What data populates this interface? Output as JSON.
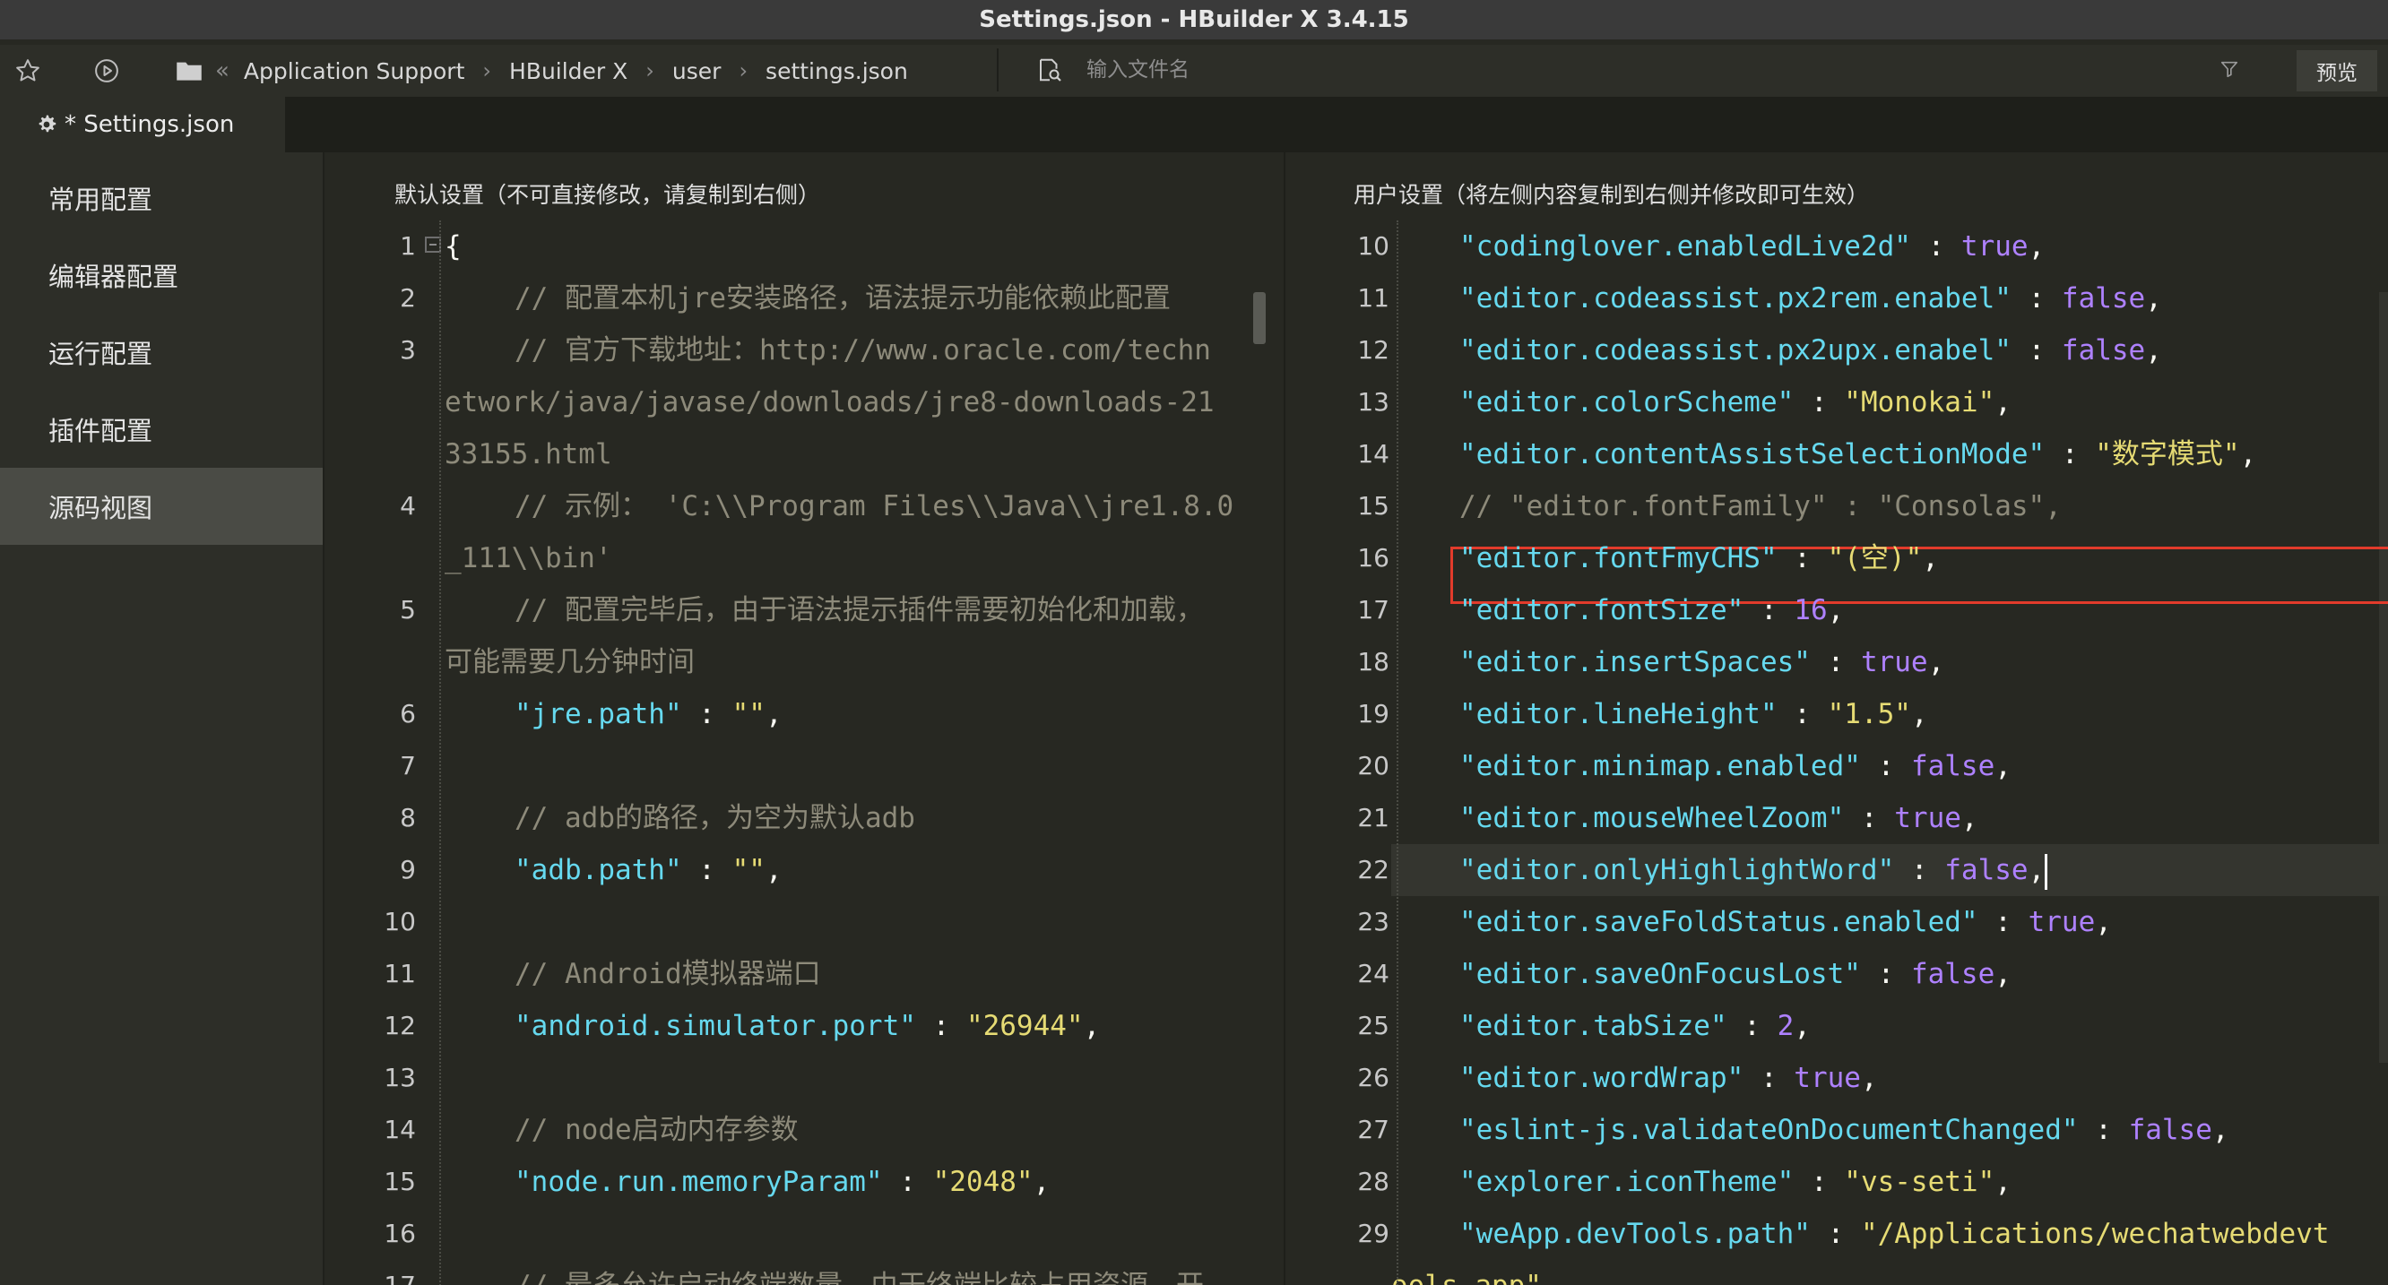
{
  "window": {
    "title": "Settings.json - HBuilder X 3.4.15"
  },
  "toolbar": {
    "breadcrumb": [
      "Application Support",
      "HBuilder X",
      "user",
      "settings.json"
    ],
    "search_placeholder": "输入文件名",
    "preview_label": "预览"
  },
  "tab": {
    "label": "* Settings.json"
  },
  "sidebar": {
    "items": [
      {
        "label": "常用配置",
        "active": false
      },
      {
        "label": "编辑器配置",
        "active": false
      },
      {
        "label": "运行配置",
        "active": false
      },
      {
        "label": "插件配置",
        "active": false
      },
      {
        "label": "源码视图",
        "active": true
      }
    ]
  },
  "left_pane": {
    "header": "默认设置（不可直接修改，请复制到右侧）",
    "lines": [
      {
        "n": "1",
        "t": [
          [
            "p",
            "{"
          ]
        ]
      },
      {
        "n": "2",
        "t": [
          [
            "c",
            "// "
          ],
          [
            "cz",
            "配置本机"
          ],
          [
            "c",
            "jre"
          ],
          [
            "cz",
            "安装路径，语法提示功能依赖此配置"
          ]
        ]
      },
      {
        "n": "3",
        "t": [
          [
            "c",
            "// "
          ],
          [
            "cz",
            "官方下载地址："
          ],
          [
            "c",
            "http://www.oracle.com/techn"
          ]
        ]
      },
      {
        "n": "",
        "t": [
          [
            "c",
            "etwork/java/javase/downloads/jre8-downloads-21"
          ]
        ]
      },
      {
        "n": "",
        "t": [
          [
            "c",
            "33155.html"
          ]
        ]
      },
      {
        "n": "4",
        "t": [
          [
            "c",
            "// "
          ],
          [
            "cz",
            "示例："
          ],
          [
            "c",
            " 'C:\\\\Program Files\\\\Java\\\\jre1.8.0"
          ]
        ]
      },
      {
        "n": "",
        "t": [
          [
            "c",
            "_111\\\\bin'"
          ]
        ]
      },
      {
        "n": "5",
        "t": [
          [
            "c",
            "// "
          ],
          [
            "cz",
            "配置完毕后，由于语法提示插件需要初始化和加载，"
          ]
        ]
      },
      {
        "n": "",
        "t": [
          [
            "cz",
            "可能需要几分钟时间"
          ]
        ]
      },
      {
        "n": "6",
        "t": [
          [
            "k",
            "\"jre.path\""
          ],
          [
            "p",
            " : "
          ],
          [
            "s",
            "\"\""
          ],
          [
            "p",
            ","
          ]
        ]
      },
      {
        "n": "7",
        "t": []
      },
      {
        "n": "8",
        "t": [
          [
            "c",
            "// adb"
          ],
          [
            "cz",
            "的路径，为空为默认"
          ],
          [
            "c",
            "adb"
          ]
        ]
      },
      {
        "n": "9",
        "t": [
          [
            "k",
            "\"adb.path\""
          ],
          [
            "p",
            " : "
          ],
          [
            "s",
            "\"\""
          ],
          [
            "p",
            ","
          ]
        ]
      },
      {
        "n": "10",
        "t": []
      },
      {
        "n": "11",
        "t": [
          [
            "c",
            "// Android"
          ],
          [
            "cz",
            "模拟器端口"
          ]
        ]
      },
      {
        "n": "12",
        "t": [
          [
            "k",
            "\"android.simulator.port\""
          ],
          [
            "p",
            " : "
          ],
          [
            "s",
            "\"26944\""
          ],
          [
            "p",
            ","
          ]
        ]
      },
      {
        "n": "13",
        "t": []
      },
      {
        "n": "14",
        "t": [
          [
            "c",
            "// node"
          ],
          [
            "cz",
            "启动内存参数"
          ]
        ]
      },
      {
        "n": "15",
        "t": [
          [
            "k",
            "\"node.run.memoryParam\""
          ],
          [
            "p",
            " : "
          ],
          [
            "s",
            "\"2048\""
          ],
          [
            "p",
            ","
          ]
        ]
      },
      {
        "n": "16",
        "t": []
      },
      {
        "n": "17",
        "t": [
          [
            "c",
            "// "
          ],
          [
            "cz",
            "最多允许启动终端数量，由于终端比较占用资源，开"
          ]
        ]
      }
    ]
  },
  "right_pane": {
    "header": "用户设置（将左侧内容复制到右侧并修改即可生效）",
    "lines": [
      {
        "n": "10",
        "t": [
          [
            "k",
            "\"codinglover.enabledLive2d\""
          ],
          [
            "p",
            " : "
          ],
          [
            "b",
            "true"
          ],
          [
            "p",
            ","
          ]
        ]
      },
      {
        "n": "11",
        "t": [
          [
            "k",
            "\"editor.codeassist.px2rem.enabel\""
          ],
          [
            "p",
            " : "
          ],
          [
            "b",
            "false"
          ],
          [
            "p",
            ","
          ]
        ]
      },
      {
        "n": "12",
        "t": [
          [
            "k",
            "\"editor.codeassist.px2upx.enabel\""
          ],
          [
            "p",
            " : "
          ],
          [
            "b",
            "false"
          ],
          [
            "p",
            ","
          ]
        ]
      },
      {
        "n": "13",
        "t": [
          [
            "k",
            "\"editor.colorScheme\""
          ],
          [
            "p",
            " : "
          ],
          [
            "s",
            "\"Monokai\""
          ],
          [
            "p",
            ","
          ]
        ]
      },
      {
        "n": "14",
        "t": [
          [
            "k",
            "\"editor.contentAssistSelectionMode\""
          ],
          [
            "p",
            " : "
          ],
          [
            "s",
            "\"数字模式\""
          ],
          [
            "p",
            ","
          ]
        ]
      },
      {
        "n": "15",
        "t": [
          [
            "c",
            "// \"editor.fontFamily\" : \"Consolas\","
          ]
        ]
      },
      {
        "n": "16",
        "t": [
          [
            "k",
            "\"editor.fontFmyCHS\""
          ],
          [
            "p",
            " : "
          ],
          [
            "s",
            "\"(空)\""
          ],
          [
            "p",
            ","
          ]
        ]
      },
      {
        "n": "17",
        "t": [
          [
            "k",
            "\"editor.fontSize\""
          ],
          [
            "p",
            " : "
          ],
          [
            "b",
            "16"
          ],
          [
            "p",
            ","
          ]
        ]
      },
      {
        "n": "18",
        "t": [
          [
            "k",
            "\"editor.insertSpaces\""
          ],
          [
            "p",
            " : "
          ],
          [
            "b",
            "true"
          ],
          [
            "p",
            ","
          ]
        ]
      },
      {
        "n": "19",
        "t": [
          [
            "k",
            "\"editor.lineHeight\""
          ],
          [
            "p",
            " : "
          ],
          [
            "s",
            "\"1.5\""
          ],
          [
            "p",
            ","
          ]
        ]
      },
      {
        "n": "20",
        "t": [
          [
            "k",
            "\"editor.minimap.enabled\""
          ],
          [
            "p",
            " : "
          ],
          [
            "b",
            "false"
          ],
          [
            "p",
            ","
          ]
        ]
      },
      {
        "n": "21",
        "t": [
          [
            "k",
            "\"editor.mouseWheelZoom\""
          ],
          [
            "p",
            " : "
          ],
          [
            "b",
            "true"
          ],
          [
            "p",
            ","
          ]
        ]
      },
      {
        "n": "22",
        "t": [
          [
            "k",
            "\"editor.onlyHighlightWord\""
          ],
          [
            "p",
            " : "
          ],
          [
            "b",
            "false"
          ],
          [
            "p",
            ","
          ]
        ]
      },
      {
        "n": "23",
        "t": [
          [
            "k",
            "\"editor.saveFoldStatus.enabled\""
          ],
          [
            "p",
            " : "
          ],
          [
            "b",
            "true"
          ],
          [
            "p",
            ","
          ]
        ]
      },
      {
        "n": "24",
        "t": [
          [
            "k",
            "\"editor.saveOnFocusLost\""
          ],
          [
            "p",
            " : "
          ],
          [
            "b",
            "false"
          ],
          [
            "p",
            ","
          ]
        ]
      },
      {
        "n": "25",
        "t": [
          [
            "k",
            "\"editor.tabSize\""
          ],
          [
            "p",
            " : "
          ],
          [
            "b",
            "2"
          ],
          [
            "p",
            ","
          ]
        ]
      },
      {
        "n": "26",
        "t": [
          [
            "k",
            "\"editor.wordWrap\""
          ],
          [
            "p",
            " : "
          ],
          [
            "b",
            "true"
          ],
          [
            "p",
            ","
          ]
        ]
      },
      {
        "n": "27",
        "t": [
          [
            "k",
            "\"eslint-js.validateOnDocumentChanged\""
          ],
          [
            "p",
            " : "
          ],
          [
            "b",
            "false"
          ],
          [
            "p",
            ","
          ]
        ]
      },
      {
        "n": "28",
        "t": [
          [
            "k",
            "\"explorer.iconTheme\""
          ],
          [
            "p",
            " : "
          ],
          [
            "s",
            "\"vs-seti\""
          ],
          [
            "p",
            ","
          ]
        ]
      },
      {
        "n": "29",
        "t": [
          [
            "k",
            "\"weApp.devTools.path\""
          ],
          [
            "p",
            " : "
          ],
          [
            "s",
            "\"/Applications/wechatwebdevt"
          ]
        ]
      },
      {
        "n": "",
        "t": [
          [
            "s",
            "ools.app\""
          ]
        ]
      }
    ]
  },
  "colors": {
    "background": "#272822",
    "keyword": "#66d9ef",
    "string": "#e6db74",
    "boolean": "#ae81ff",
    "comment": "#8d8a7a",
    "highlight_box": "#e23b2b"
  },
  "icons": [
    "star-icon",
    "play-icon",
    "folder-icon",
    "search-file-icon",
    "filter-icon",
    "gear-icon"
  ]
}
